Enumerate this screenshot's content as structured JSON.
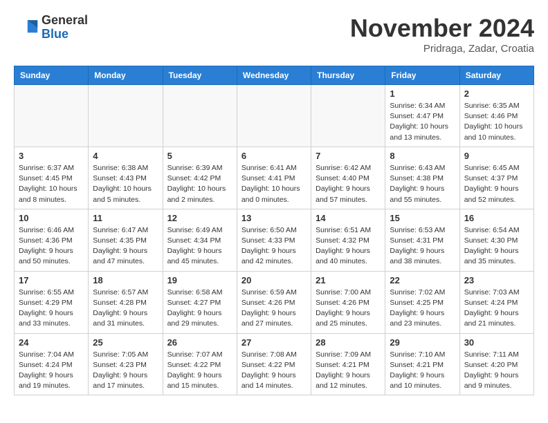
{
  "header": {
    "logo_general": "General",
    "logo_blue": "Blue",
    "month_title": "November 2024",
    "subtitle": "Pridraga, Zadar, Croatia"
  },
  "weekdays": [
    "Sunday",
    "Monday",
    "Tuesday",
    "Wednesday",
    "Thursday",
    "Friday",
    "Saturday"
  ],
  "weeks": [
    [
      {
        "day": "",
        "detail": ""
      },
      {
        "day": "",
        "detail": ""
      },
      {
        "day": "",
        "detail": ""
      },
      {
        "day": "",
        "detail": ""
      },
      {
        "day": "",
        "detail": ""
      },
      {
        "day": "1",
        "detail": "Sunrise: 6:34 AM\nSunset: 4:47 PM\nDaylight: 10 hours and 13 minutes."
      },
      {
        "day": "2",
        "detail": "Sunrise: 6:35 AM\nSunset: 4:46 PM\nDaylight: 10 hours and 10 minutes."
      }
    ],
    [
      {
        "day": "3",
        "detail": "Sunrise: 6:37 AM\nSunset: 4:45 PM\nDaylight: 10 hours and 8 minutes."
      },
      {
        "day": "4",
        "detail": "Sunrise: 6:38 AM\nSunset: 4:43 PM\nDaylight: 10 hours and 5 minutes."
      },
      {
        "day": "5",
        "detail": "Sunrise: 6:39 AM\nSunset: 4:42 PM\nDaylight: 10 hours and 2 minutes."
      },
      {
        "day": "6",
        "detail": "Sunrise: 6:41 AM\nSunset: 4:41 PM\nDaylight: 10 hours and 0 minutes."
      },
      {
        "day": "7",
        "detail": "Sunrise: 6:42 AM\nSunset: 4:40 PM\nDaylight: 9 hours and 57 minutes."
      },
      {
        "day": "8",
        "detail": "Sunrise: 6:43 AM\nSunset: 4:38 PM\nDaylight: 9 hours and 55 minutes."
      },
      {
        "day": "9",
        "detail": "Sunrise: 6:45 AM\nSunset: 4:37 PM\nDaylight: 9 hours and 52 minutes."
      }
    ],
    [
      {
        "day": "10",
        "detail": "Sunrise: 6:46 AM\nSunset: 4:36 PM\nDaylight: 9 hours and 50 minutes."
      },
      {
        "day": "11",
        "detail": "Sunrise: 6:47 AM\nSunset: 4:35 PM\nDaylight: 9 hours and 47 minutes."
      },
      {
        "day": "12",
        "detail": "Sunrise: 6:49 AM\nSunset: 4:34 PM\nDaylight: 9 hours and 45 minutes."
      },
      {
        "day": "13",
        "detail": "Sunrise: 6:50 AM\nSunset: 4:33 PM\nDaylight: 9 hours and 42 minutes."
      },
      {
        "day": "14",
        "detail": "Sunrise: 6:51 AM\nSunset: 4:32 PM\nDaylight: 9 hours and 40 minutes."
      },
      {
        "day": "15",
        "detail": "Sunrise: 6:53 AM\nSunset: 4:31 PM\nDaylight: 9 hours and 38 minutes."
      },
      {
        "day": "16",
        "detail": "Sunrise: 6:54 AM\nSunset: 4:30 PM\nDaylight: 9 hours and 35 minutes."
      }
    ],
    [
      {
        "day": "17",
        "detail": "Sunrise: 6:55 AM\nSunset: 4:29 PM\nDaylight: 9 hours and 33 minutes."
      },
      {
        "day": "18",
        "detail": "Sunrise: 6:57 AM\nSunset: 4:28 PM\nDaylight: 9 hours and 31 minutes."
      },
      {
        "day": "19",
        "detail": "Sunrise: 6:58 AM\nSunset: 4:27 PM\nDaylight: 9 hours and 29 minutes."
      },
      {
        "day": "20",
        "detail": "Sunrise: 6:59 AM\nSunset: 4:26 PM\nDaylight: 9 hours and 27 minutes."
      },
      {
        "day": "21",
        "detail": "Sunrise: 7:00 AM\nSunset: 4:26 PM\nDaylight: 9 hours and 25 minutes."
      },
      {
        "day": "22",
        "detail": "Sunrise: 7:02 AM\nSunset: 4:25 PM\nDaylight: 9 hours and 23 minutes."
      },
      {
        "day": "23",
        "detail": "Sunrise: 7:03 AM\nSunset: 4:24 PM\nDaylight: 9 hours and 21 minutes."
      }
    ],
    [
      {
        "day": "24",
        "detail": "Sunrise: 7:04 AM\nSunset: 4:24 PM\nDaylight: 9 hours and 19 minutes."
      },
      {
        "day": "25",
        "detail": "Sunrise: 7:05 AM\nSunset: 4:23 PM\nDaylight: 9 hours and 17 minutes."
      },
      {
        "day": "26",
        "detail": "Sunrise: 7:07 AM\nSunset: 4:22 PM\nDaylight: 9 hours and 15 minutes."
      },
      {
        "day": "27",
        "detail": "Sunrise: 7:08 AM\nSunset: 4:22 PM\nDaylight: 9 hours and 14 minutes."
      },
      {
        "day": "28",
        "detail": "Sunrise: 7:09 AM\nSunset: 4:21 PM\nDaylight: 9 hours and 12 minutes."
      },
      {
        "day": "29",
        "detail": "Sunrise: 7:10 AM\nSunset: 4:21 PM\nDaylight: 9 hours and 10 minutes."
      },
      {
        "day": "30",
        "detail": "Sunrise: 7:11 AM\nSunset: 4:20 PM\nDaylight: 9 hours and 9 minutes."
      }
    ]
  ]
}
